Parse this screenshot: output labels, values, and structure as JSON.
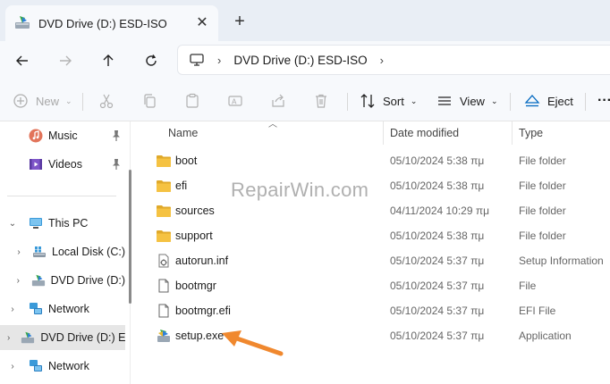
{
  "tab": {
    "title": "DVD Drive (D:) ESD-ISO",
    "close": "✕",
    "new_tab": "+"
  },
  "address": {
    "crumb": "DVD Drive (D:) ESD-ISO"
  },
  "toolbar": {
    "new_label": "New",
    "sort_label": "Sort",
    "view_label": "View",
    "eject_label": "Eject",
    "more": "···"
  },
  "nav": {
    "music": "Music",
    "videos": "Videos",
    "this_pc": "This PC",
    "local_disk": "Local Disk (C:)",
    "dvd_drive": "DVD Drive (D:)",
    "network1": "Network",
    "dvd_drive_selected": "DVD Drive (D:) E",
    "network2": "Network"
  },
  "columns": {
    "name": "Name",
    "date": "Date modified",
    "type": "Type"
  },
  "files": [
    {
      "name": "boot",
      "date": "05/10/2024 5:38 πμ",
      "type": "File folder",
      "icon": "folder"
    },
    {
      "name": "efi",
      "date": "05/10/2024 5:38 πμ",
      "type": "File folder",
      "icon": "folder"
    },
    {
      "name": "sources",
      "date": "04/11/2024 10:29 πμ",
      "type": "File folder",
      "icon": "folder"
    },
    {
      "name": "support",
      "date": "05/10/2024 5:38 πμ",
      "type": "File folder",
      "icon": "folder"
    },
    {
      "name": "autorun.inf",
      "date": "05/10/2024 5:37 πμ",
      "type": "Setup Information",
      "icon": "setup-info"
    },
    {
      "name": "bootmgr",
      "date": "05/10/2024 5:37 πμ",
      "type": "File",
      "icon": "file"
    },
    {
      "name": "bootmgr.efi",
      "date": "05/10/2024 5:37 πμ",
      "type": "EFI File",
      "icon": "file"
    },
    {
      "name": "setup.exe",
      "date": "05/10/2024 5:37 πμ",
      "type": "Application",
      "icon": "setup-app"
    }
  ],
  "watermark": "RepairWin.com",
  "colors": {
    "folder": "#f5c242",
    "folder_dark": "#e0a92a",
    "accent": "#0067c0",
    "arrow": "#f0882e"
  }
}
